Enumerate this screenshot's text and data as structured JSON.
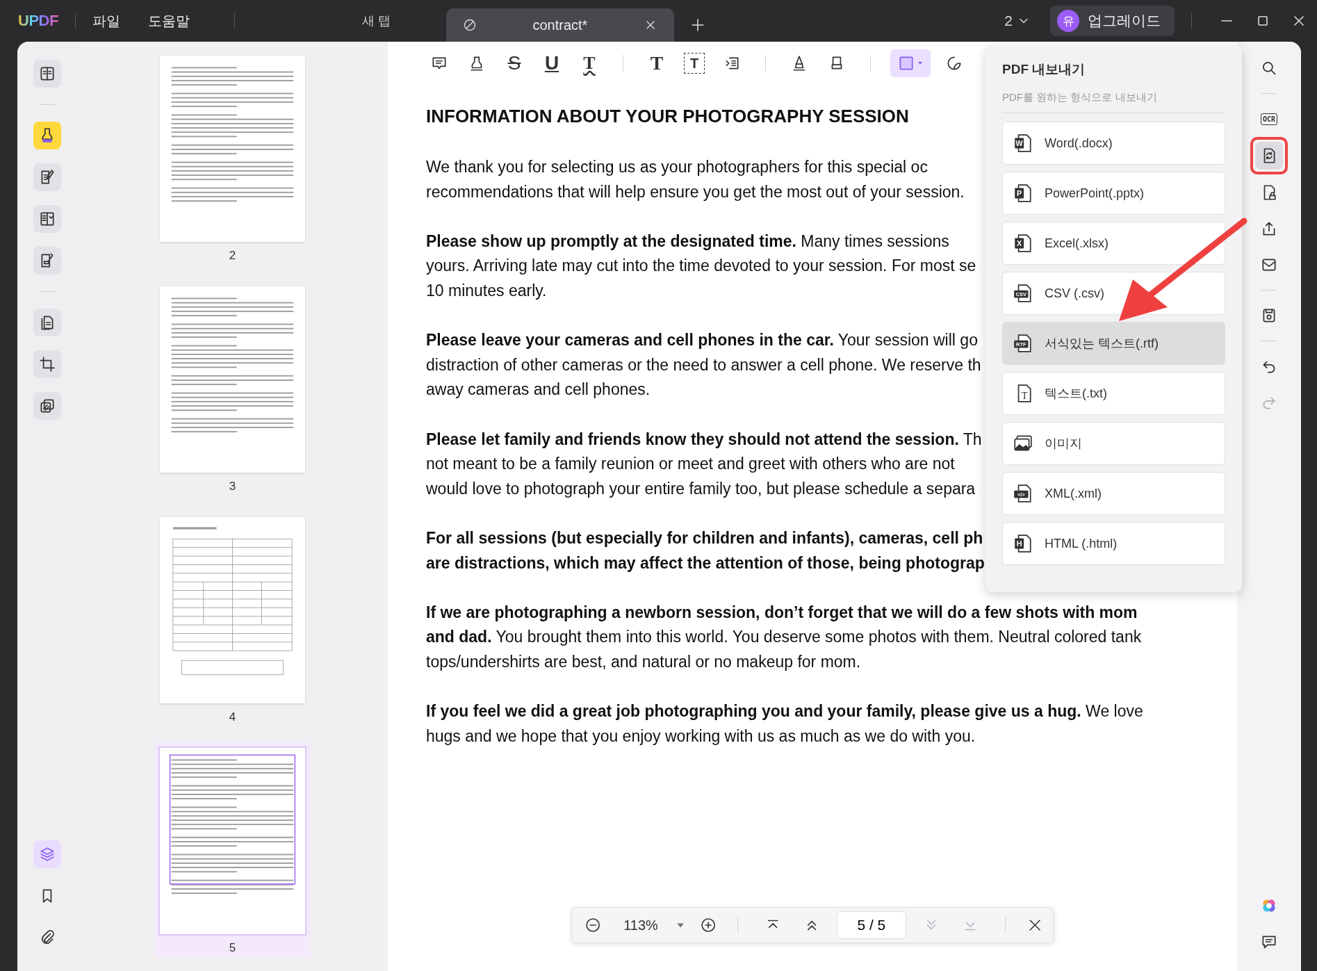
{
  "titlebar": {
    "logo": "UPDF",
    "menus": [
      "파일",
      "도움말"
    ],
    "tabs": [
      {
        "label": "새 탭",
        "selected": false,
        "closable": false
      },
      {
        "label": "contract*",
        "selected": true,
        "closable": true
      }
    ],
    "window_count": "2",
    "avatar": "유",
    "upgrade": "업그레이드"
  },
  "left_toolbar": {
    "groups": [
      [
        {
          "kind": "reader",
          "selected": false
        }
      ],
      [
        {
          "kind": "highlight",
          "selected": true
        },
        {
          "kind": "edit",
          "selected": false
        },
        {
          "kind": "organize",
          "selected": false
        },
        {
          "kind": "form",
          "selected": false
        }
      ],
      [
        {
          "kind": "pages",
          "selected": false
        },
        {
          "kind": "crop",
          "selected": false
        },
        {
          "kind": "compare",
          "selected": false
        }
      ]
    ],
    "bottom": [
      {
        "kind": "layers",
        "selected": true
      },
      {
        "kind": "bookmark",
        "selected": false
      },
      {
        "kind": "attach",
        "selected": false
      }
    ]
  },
  "thumbnails": [
    {
      "page": "2",
      "kind": "text",
      "selected": false
    },
    {
      "page": "3",
      "kind": "text",
      "selected": false
    },
    {
      "page": "4",
      "kind": "form",
      "selected": false
    },
    {
      "page": "5",
      "kind": "annotated",
      "selected": true
    }
  ],
  "annotation_tools": [
    [
      {
        "kind": "comment",
        "selected": false
      },
      {
        "kind": "highlighter",
        "selected": false
      },
      {
        "kind": "strike",
        "glyph": "S",
        "selected": false
      },
      {
        "kind": "underline",
        "glyph": "U",
        "selected": false
      },
      {
        "kind": "squiggly",
        "glyph": "T",
        "selected": false
      }
    ],
    [
      {
        "kind": "text",
        "glyph": "T",
        "selected": false
      },
      {
        "kind": "textbox",
        "glyph": "T",
        "selected": false
      },
      {
        "kind": "callout",
        "selected": false
      }
    ],
    [
      {
        "kind": "pencil",
        "selected": false
      },
      {
        "kind": "eraser",
        "selected": false
      }
    ],
    [
      {
        "kind": "rectangle",
        "selected": true
      },
      {
        "kind": "sticker",
        "selected": false
      }
    ]
  ],
  "document": {
    "title": "INFORMATION ABOUT YOUR PHOTOGRAPHY SESSION",
    "paragraphs": [
      [
        "We thank you for selecting us as your photographers for this special oc",
        "recommendations that will help ensure you get the most out of your session."
      ],
      [
        "**Please show up promptly at the designated time.** Many times sessions",
        "yours. Arriving late may cut into the time devoted to your session. For most se",
        "10 minutes early."
      ],
      [
        "**Please leave your cameras and cell phones in the car.** Your session will go",
        "distraction of other cameras or the need to answer a cell phone. We reserve th",
        "away cameras and cell phones."
      ],
      [
        "**Please let family and friends know they should not attend the session.** Th",
        "not meant to be a family reunion or meet and greet with others who are not",
        "would love to photograph your entire family too, but please schedule a separa"
      ],
      [
        "**For all sessions (but especially for children and infants), cameras, cell ph**",
        "**are distractions, which may affect the attention of those, being photograp**"
      ],
      [
        "**If we are photographing a newborn session, don’t forget that we will do a few shots with mom**",
        "**and dad.** You brought them into this world. You deserve some photos with them. Neutral colored tank",
        "tops/undershirts are best, and natural or no makeup for mom."
      ],
      [
        "**If you feel we did a great job photographing you and your family, please give us a hug.** We love",
        "hugs and we hope that you enjoy working with us as much as we do with you."
      ]
    ]
  },
  "export_panel": {
    "title": "PDF 내보내기",
    "subtitle": "PDF를 원하는 형식으로 내보내기",
    "items": [
      {
        "kind": "badge",
        "badge": "W",
        "label": "Word(.docx)",
        "selected": false
      },
      {
        "kind": "badge",
        "badge": "P",
        "label": "PowerPoint(.pptx)",
        "selected": false
      },
      {
        "kind": "badge",
        "badge": "X",
        "label": "Excel(.xlsx)",
        "selected": false
      },
      {
        "kind": "tag",
        "badge": "CSV",
        "label": "CSV (.csv)",
        "selected": false
      },
      {
        "kind": "tag",
        "badge": "RTF",
        "label": "서식있는 텍스트(.rtf)",
        "selected": true
      },
      {
        "kind": "serif",
        "badge": "T",
        "label": "텍스트(.txt)",
        "selected": false
      },
      {
        "kind": "image",
        "label": "이미지",
        "selected": false
      },
      {
        "kind": "tag",
        "badge": "</>",
        "label": "XML(.xml)",
        "selected": false
      },
      {
        "kind": "badge",
        "badge": "H",
        "label": "HTML (.html)",
        "selected": false
      }
    ]
  },
  "right_toolbar": {
    "groups": [
      [
        {
          "kind": "search",
          "selected": false,
          "disabled": false
        }
      ],
      [
        {
          "kind": "ocr",
          "glyph": "OCR",
          "selected": false,
          "disabled": false
        },
        {
          "kind": "convert",
          "selected": true,
          "disabled": false,
          "marked": true
        },
        {
          "kind": "protect",
          "selected": false,
          "disabled": false
        },
        {
          "kind": "share",
          "selected": false,
          "disabled": false
        },
        {
          "kind": "mail",
          "selected": false,
          "disabled": false
        }
      ],
      [
        {
          "kind": "save",
          "selected": false,
          "disabled": false
        }
      ],
      [
        {
          "kind": "undo",
          "selected": false,
          "disabled": false
        },
        {
          "kind": "redo",
          "selected": false,
          "disabled": true
        }
      ]
    ],
    "bottom": [
      {
        "kind": "ai",
        "selected": false,
        "disabled": false
      },
      {
        "kind": "chat",
        "selected": false,
        "disabled": false
      }
    ]
  },
  "page_nav": {
    "zoom": "113%",
    "page": "5 / 5",
    "buttons": [
      {
        "kind": "first",
        "disabled": false
      },
      {
        "kind": "prev",
        "disabled": false
      },
      {
        "kind": "next",
        "disabled": true
      },
      {
        "kind": "last",
        "disabled": true
      }
    ]
  }
}
